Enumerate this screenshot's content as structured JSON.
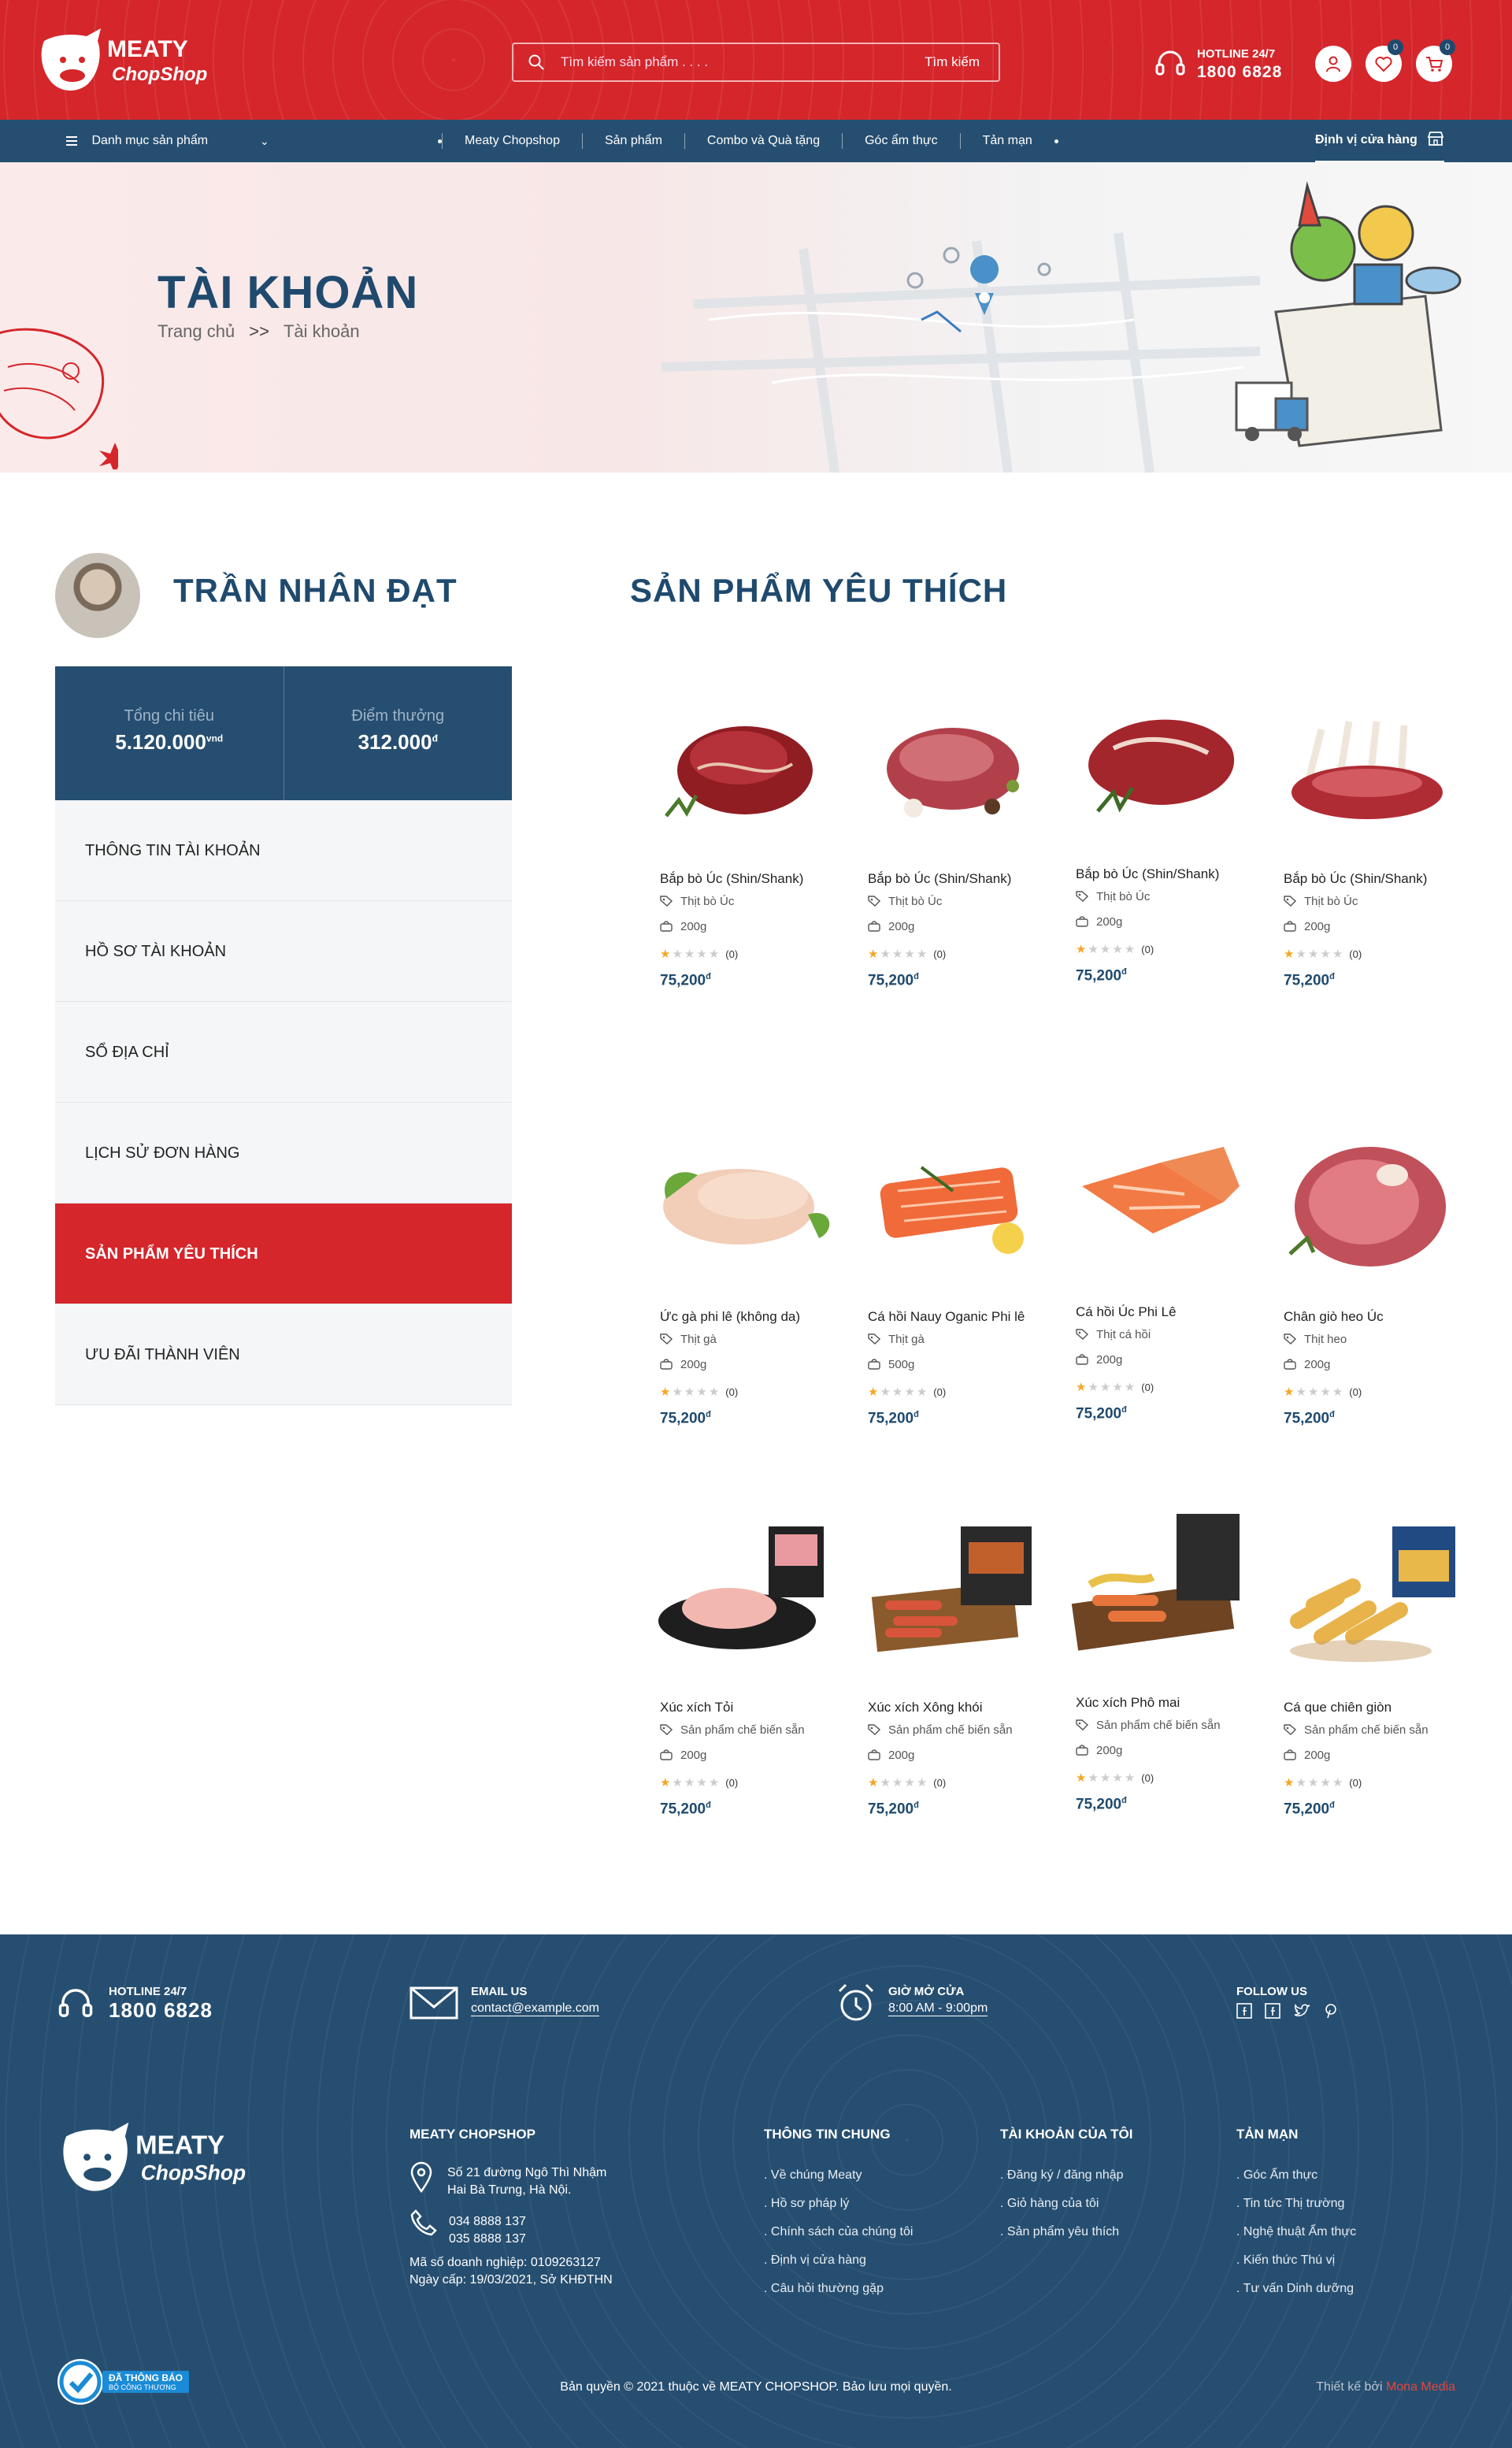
{
  "header": {
    "logo_text_1": "MEATY",
    "logo_text_2": "ChopShop",
    "search_placeholder": "Tìm kiếm sản phẩm . . . .",
    "search_button": "Tìm kiếm",
    "hotline_label": "HOTLINE 24/7",
    "hotline_number": "1800 6828",
    "wishlist_count": "0",
    "cart_count": "0"
  },
  "nav": {
    "categories": "Danh mục sản phẩm",
    "links": [
      "Meaty Chopshop",
      "Sản phẩm",
      "Combo và Quà tặng",
      "Góc ẩm thực",
      "Tản mạn"
    ],
    "locate_store": "Định vị cửa hàng"
  },
  "banner": {
    "title": "TÀI KHOẢN",
    "breadcrumb_home": "Trang chủ",
    "breadcrumb_sep": ">>",
    "breadcrumb_current": "Tài khoản"
  },
  "account": {
    "name": "TRẦN NHÂN ĐẠT",
    "total_spent_label": "Tổng chi tiêu",
    "total_spent_value": "5.120.000",
    "total_spent_unit": "vnd",
    "points_label": "Điểm thưởng",
    "points_value": "312.000",
    "points_unit": "đ",
    "menu": [
      "THÔNG TIN TÀI KHOẢN",
      "HỒ SƠ TÀI KHOẢN",
      "SỔ ĐỊA CHỈ",
      "LỊCH SỬ ĐƠN HÀNG",
      "SẢN PHẨM YÊU THÍCH",
      "ƯU ĐÃI THÀNH VIÊN"
    ],
    "active_index": 4
  },
  "favorites": {
    "title": "SẢN PHẨM YÊU THÍCH",
    "products": [
      {
        "name": "Bắp bò Úc (Shin/Shank)",
        "category": "Thịt bò Úc",
        "weight": "200g",
        "reviews": "(0)",
        "rating": 1,
        "price": "75,200",
        "unit": "đ",
        "img": "beef"
      },
      {
        "name": "Bắp bò Úc (Shin/Shank)",
        "category": "Thịt bò Úc",
        "weight": "200g",
        "reviews": "(0)",
        "rating": 1,
        "price": "75,200",
        "unit": "đ",
        "img": "beef2"
      },
      {
        "name": "Bắp bò Úc (Shin/Shank)",
        "category": "Thịt bò Úc",
        "weight": "200g",
        "reviews": "(0)",
        "rating": 1,
        "price": "75,200",
        "unit": "đ",
        "img": "steak"
      },
      {
        "name": "Bắp bò Úc (Shin/Shank)",
        "category": "Thịt bò Úc",
        "weight": "200g",
        "reviews": "(0)",
        "rating": 1,
        "price": "75,200",
        "unit": "đ",
        "img": "ribs"
      },
      {
        "name": "Ức gà phi lê (không da)",
        "category": "Thịt gà",
        "weight": "200g",
        "reviews": "(0)",
        "rating": 1,
        "price": "75,200",
        "unit": "đ",
        "img": "chicken"
      },
      {
        "name": "Cá hồi Nauy Oganic Phi lê",
        "category": "Thịt gà",
        "weight": "500g",
        "reviews": "(0)",
        "rating": 1,
        "price": "75,200",
        "unit": "đ",
        "img": "salmon"
      },
      {
        "name": "Cá hồi Úc Phi Lê",
        "category": "Thịt cá hồi",
        "weight": "200g",
        "reviews": "(0)",
        "rating": 1,
        "price": "75,200",
        "unit": "đ",
        "img": "salmon2"
      },
      {
        "name": "Chân giò heo Úc",
        "category": "Thịt heo",
        "weight": "200g",
        "reviews": "(0)",
        "rating": 1,
        "price": "75,200",
        "unit": "đ",
        "img": "ham"
      },
      {
        "name": "Xúc xích Tỏi",
        "category": "Sản phẩm chế biến sẵn",
        "weight": "200g",
        "reviews": "(0)",
        "rating": 1,
        "price": "75,200",
        "unit": "đ",
        "img": "sausage1"
      },
      {
        "name": "Xúc xích Xông khói",
        "category": "Sản phẩm chế biến sẵn",
        "weight": "200g",
        "reviews": "(0)",
        "rating": 1,
        "price": "75,200",
        "unit": "đ",
        "img": "sausage2"
      },
      {
        "name": "Xúc xích Phô mai",
        "category": "Sản phẩm chế biến sẵn",
        "weight": "200g",
        "reviews": "(0)",
        "rating": 1,
        "price": "75,200",
        "unit": "đ",
        "img": "sausage3"
      },
      {
        "name": "Cá que chiên giòn",
        "category": "Sản phẩm chế biến sẵn",
        "weight": "200g",
        "reviews": "(0)",
        "rating": 1,
        "price": "75,200",
        "unit": "đ",
        "img": "fishstick"
      }
    ]
  },
  "footer": {
    "hotline_label": "HOTLINE 24/7",
    "hotline_number": "1800 6828",
    "email_label": "EMAIL US",
    "email_value": "contact@example.com",
    "hours_label": "GIỜ MỞ CỬA",
    "hours_value": "8:00 AM  -  9:00pm",
    "follow_label": "FOLLOW US",
    "company_heading": "MEATY CHOPSHOP",
    "address_line1": "Số 21 đường Ngô Thì Nhậm",
    "address_line2": "Hai Bà Trưng, Hà Nội.",
    "phone1": "034 8888 137",
    "phone2": "035 8888 137",
    "business_id": "Mã số doanh nghiệp: 0109263127",
    "issued": "Ngày cấp: 19/03/2021, Sở KHĐTHN",
    "col_general_heading": "THÔNG TIN CHUNG",
    "col_general": [
      "Về chúng Meaty",
      "Hồ sơ pháp lý",
      "Chính sách của chúng tôi",
      "Định vị cửa hàng",
      "Câu hỏi thường gặp"
    ],
    "col_account_heading": "TÀI KHOẢN CỦA TÔI",
    "col_account": [
      "Đăng ký / đăng nhập",
      "Giỏ hàng của tôi",
      "Sản phẩm yêu thích"
    ],
    "col_misc_heading": "TẢN MẠN",
    "col_misc": [
      "Góc Ẩm thực",
      "Tin tức Thị trường",
      "Nghệ thuật Ẩm thực",
      "Kiến thức Thú vị",
      "Tư vấn Dinh dưỡng"
    ],
    "badge_line1": "ĐÃ THÔNG BÁO",
    "badge_line2": "BỘ CÔNG THƯƠNG",
    "copyright": "Bản quyền © 2021 thuộc về MEATY CHOPSHOP. Bảo lưu mọi quyền.",
    "designer_label": "Thiết kế bởi",
    "designer_name": "Mona Media"
  },
  "colors": {
    "brand_red": "#d4262b",
    "navy": "#264e70",
    "star": "#f5a623"
  }
}
